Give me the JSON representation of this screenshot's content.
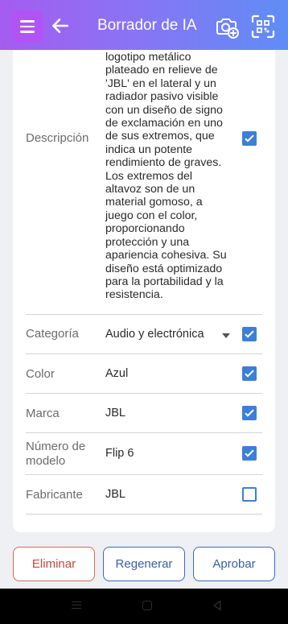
{
  "header": {
    "title": "Borrador de IA",
    "menu_icon": "hamburger-menu-icon",
    "back_icon": "arrow-left-icon",
    "camera_icon": "camera-add-icon",
    "scan_icon": "scan-qr-icon",
    "gradient_start": "#a55cf0",
    "gradient_end": "#5f8df5"
  },
  "form": {
    "description": {
      "label": "Descripción",
      "lines": [
        "logotipo metálico",
        "plateado en relieve de",
        "'JBL' en el lateral y un",
        "radiador pasivo visible",
        "con un diseño de signo",
        "de exclamación en uno",
        "de sus extremos, que",
        "indica un potente",
        "rendimiento de graves.",
        "Los extremos del",
        "altavoz son de un",
        "material gomoso, a",
        "juego con el color,",
        "proporcionando",
        "protección y una",
        "apariencia cohesiva. Su",
        "diseño está optimizado",
        "para la portabilidad y la",
        "resistencia."
      ],
      "checked": true
    },
    "rows": [
      {
        "label": "Categoría",
        "value": "Audio y electrónica",
        "dropdown": true,
        "checked": true
      },
      {
        "label": "Color",
        "value": "Azul",
        "checked": true
      },
      {
        "label": "Marca",
        "value": "JBL",
        "checked": true
      },
      {
        "label_line1": "Número de",
        "label_line2": "modelo",
        "value": "Flip 6",
        "checked": true
      },
      {
        "label": "Fabricante",
        "value": "JBL",
        "checked": false
      }
    ]
  },
  "actions": {
    "delete_label": "Eliminar",
    "regenerate_label": "Regenerar",
    "approve_label": "Aprobar"
  },
  "colors": {
    "accent": "#3d7fd6",
    "delete": "#c9473a",
    "secondary": "#3a5fa6"
  }
}
